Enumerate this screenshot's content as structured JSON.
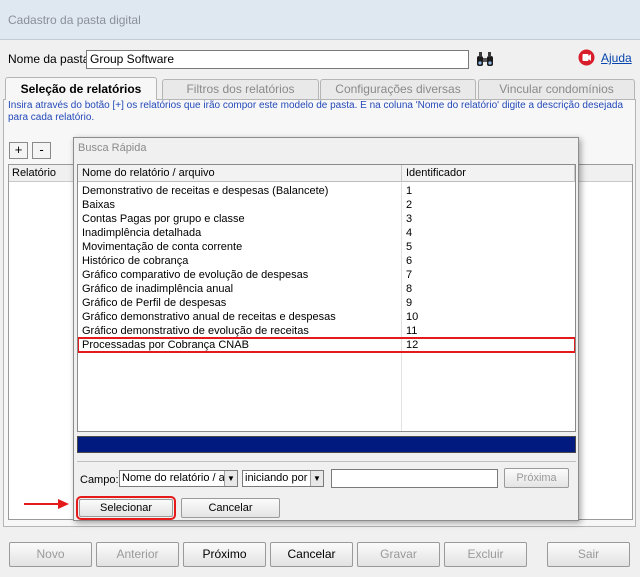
{
  "window": {
    "title": "Cadastro da pasta digital"
  },
  "header": {
    "pasta_label": "Nome da pasta:",
    "pasta_value": "Group Software",
    "help_label": "Ajuda"
  },
  "tabs": [
    {
      "label": "Seleção de relatórios",
      "active": true
    },
    {
      "label": "Filtros dos relatórios",
      "active": false
    },
    {
      "label": "Configurações diversas",
      "active": false
    },
    {
      "label": "Vincular condomínios",
      "active": false
    }
  ],
  "instruction": "Insira através do botão [+] os relatórios que irão compor este modelo de pasta. E na coluna 'Nome do relatório' digite a descrição desejada para cada relatório.",
  "toolbar": {
    "add_label": "+",
    "remove_label": "-"
  },
  "background_grid": {
    "column_header": "Relatório"
  },
  "dialog": {
    "title": "Busca Rápida",
    "columns": [
      "Nome do relatório / arquivo",
      "Identificador"
    ],
    "rows": [
      {
        "name": "Demonstrativo de receitas e despesas (Balancete)",
        "id": "1"
      },
      {
        "name": "Baixas",
        "id": "2"
      },
      {
        "name": "Contas Pagas por grupo e classe",
        "id": "3"
      },
      {
        "name": "Inadimplência detalhada",
        "id": "4"
      },
      {
        "name": "Movimentação de conta corrente",
        "id": "5"
      },
      {
        "name": "Histórico de cobrança",
        "id": "6"
      },
      {
        "name": "Gráfico comparativo de evolução de despesas",
        "id": "7"
      },
      {
        "name": "Gráfico de inadimplência anual",
        "id": "8"
      },
      {
        "name": "Gráfico de Perfil de despesas",
        "id": "9"
      },
      {
        "name": "Gráfico demonstrativo anual de receitas e despesas",
        "id": "10"
      },
      {
        "name": "Gráfico demonstrativo de evolução de receitas",
        "id": "11"
      },
      {
        "name": "Processadas por Cobrança CNAB",
        "id": "12",
        "selected": true
      }
    ],
    "search": {
      "field_label": "Campo:",
      "field_select": "Nome do relatório / a",
      "mode_select": "iniciando por",
      "value": "",
      "next_label": "Próxima"
    },
    "select_label": "Selecionar",
    "cancel_label": "Cancelar"
  },
  "bottom_buttons": [
    {
      "label": "Novo",
      "enabled": false
    },
    {
      "label": "Anterior",
      "enabled": false
    },
    {
      "label": "Próximo",
      "enabled": true
    },
    {
      "label": "Cancelar",
      "enabled": true
    },
    {
      "label": "Gravar",
      "enabled": false
    },
    {
      "label": "Excluir",
      "enabled": false
    },
    {
      "label": "Sair",
      "enabled": false
    }
  ],
  "colors": {
    "highlight": "#e51a1a",
    "title_bar": "#dfe7f1",
    "progress_bar": "#001a80",
    "help_link": "#0645ad",
    "instruction_text": "#2449b8"
  },
  "icons": {
    "search": "binoculars-icon",
    "help": "help-icon"
  }
}
